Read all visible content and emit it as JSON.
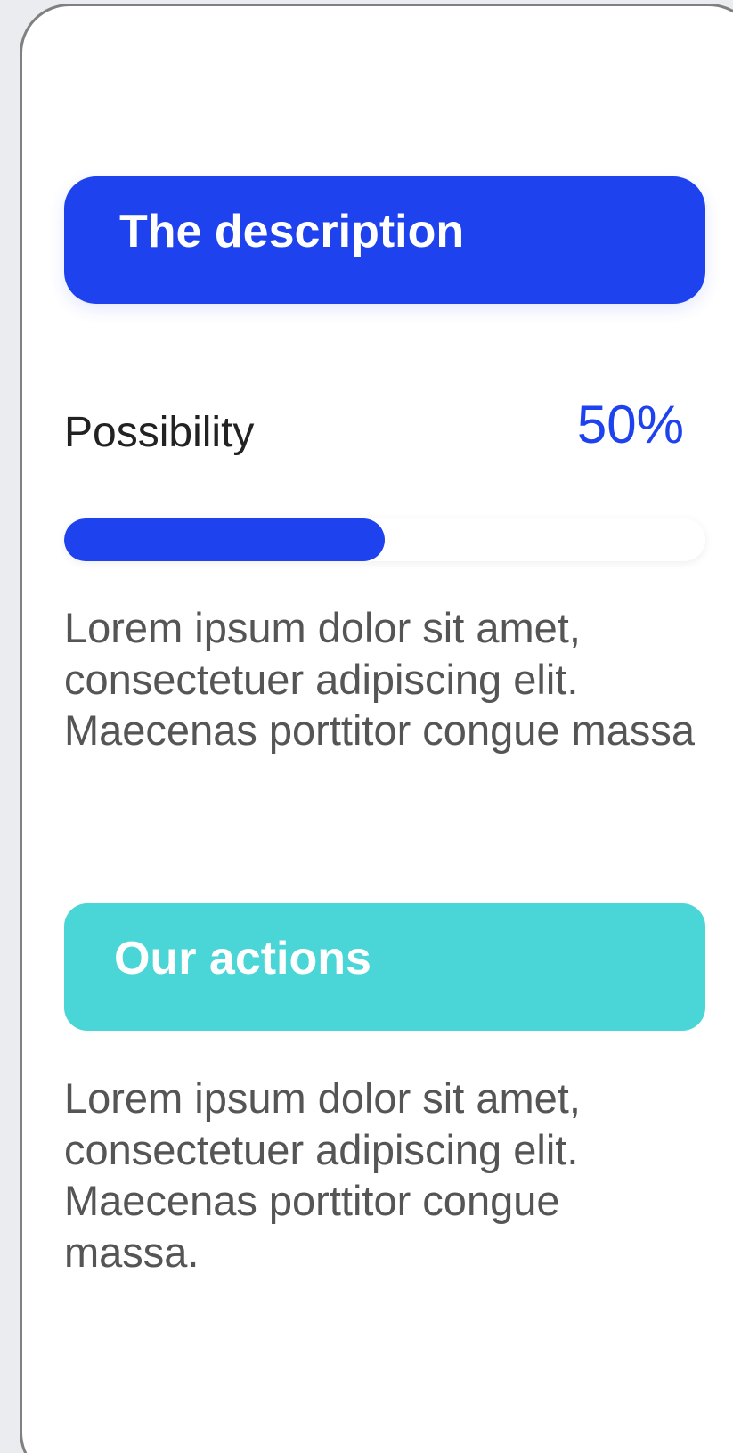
{
  "description_section": {
    "header_label": "The description",
    "accent_color": "#1f42ef",
    "possibility_label": "Possibility",
    "possibility_value": "50%",
    "progress_fraction": 0.5,
    "body_text": "Lorem ipsum dolor sit amet, consectetuer adipiscing elit. Maecenas porttitor congue massa"
  },
  "actions_section": {
    "header_label": "Our actions",
    "accent_color": "#4ad6d6",
    "body_text": "Lorem ipsum dolor sit amet, consectetuer adipiscing elit. Maecenas porttitor congue massa."
  }
}
